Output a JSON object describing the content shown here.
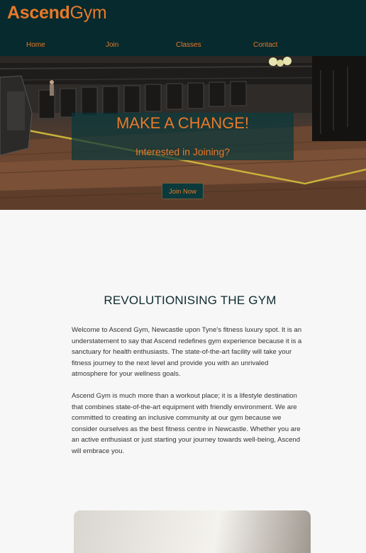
{
  "brand": {
    "bold": "Ascend",
    "light": "Gym"
  },
  "nav": {
    "items": [
      "Home",
      "Join",
      "Classes",
      "Contact"
    ]
  },
  "hero": {
    "title": "MAKE A CHANGE!",
    "subtitle": "Interested in Joining?",
    "button": "Join Now"
  },
  "about": {
    "title": "REVOLUTIONISING THE GYM",
    "p1": "Welcome to Ascend Gym, Newcastle upon Tyne's fitness luxury spot. It is an understatement to say that Ascend redefines gym experience because it is a sanctuary for health enthusiasts. The state-of-the-art facility will take your fitness journey to the next level and provide you with an unrivaled atmosphere for your wellness goals.",
    "p2": "Ascend Gym is much more than a workout place; it is a lifestyle destination that combines state-of-the-art equipment with friendly environment. We are committed to creating an inclusive community at our gym because we consider ourselves as the best fitness centre in Newcastle. Whether you are an active enthusiast or just starting your journey towards well-being, Ascend will embrace you."
  },
  "colors": {
    "accent": "#e8792a",
    "header": "#062a2d"
  }
}
